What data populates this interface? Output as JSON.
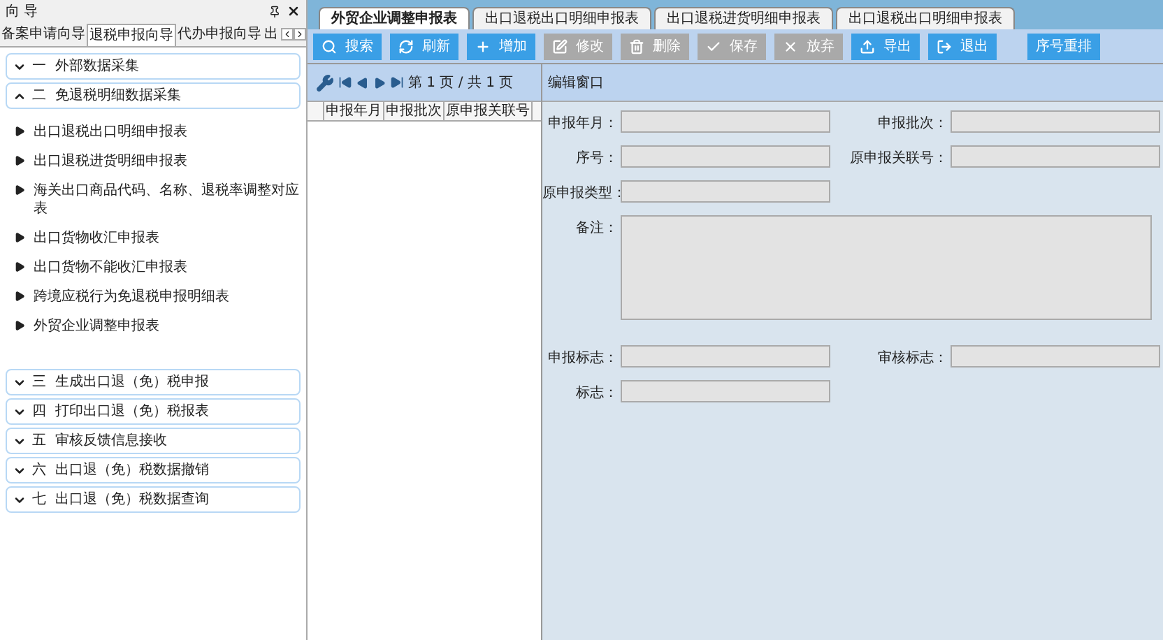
{
  "guide": {
    "title": "向 导",
    "tabs": [
      {
        "label": "备案申请向导",
        "selected": false
      },
      {
        "label": "退税申报向导",
        "selected": true
      },
      {
        "label": "代办申报向导",
        "selected": false
      },
      {
        "label": "出",
        "selected": false
      }
    ],
    "sections": [
      {
        "label": "一  外部数据采集",
        "expanded": false
      },
      {
        "label": "二  免退税明细数据采集",
        "expanded": true,
        "items": [
          "出口退税出口明细申报表",
          "出口退税进货明细申报表",
          "海关出口商品代码、名称、退税率调整对应表",
          "出口货物收汇申报表",
          "出口货物不能收汇申报表",
          "跨境应税行为免退税申报明细表",
          "外贸企业调整申报表"
        ]
      },
      {
        "label": "三  生成出口退（免）税申报",
        "expanded": false
      },
      {
        "label": "四  打印出口退（免）税报表",
        "expanded": false
      },
      {
        "label": "五  审核反馈信息接收",
        "expanded": false
      },
      {
        "label": "六  出口退（免）税数据撤销",
        "expanded": false
      },
      {
        "label": "七  出口退（免）税数据查询",
        "expanded": false
      }
    ]
  },
  "tabs": [
    {
      "label": "外贸企业调整申报表",
      "selected": true
    },
    {
      "label": "出口退税出口明细申报表",
      "selected": false
    },
    {
      "label": "出口退税进货明细申报表",
      "selected": false
    },
    {
      "label": "出口退税出口明细申报表",
      "selected": false
    }
  ],
  "toolbar": [
    {
      "label": "搜索",
      "kind": "search",
      "disabled": false
    },
    {
      "label": "刷新",
      "kind": "refresh",
      "disabled": false
    },
    {
      "label": "增加",
      "kind": "add",
      "disabled": false
    },
    {
      "label": "修改",
      "kind": "edit",
      "disabled": true
    },
    {
      "label": "删除",
      "kind": "delete",
      "disabled": true
    },
    {
      "label": "保存",
      "kind": "save",
      "disabled": true
    },
    {
      "label": "放弃",
      "kind": "cancel",
      "disabled": true
    },
    {
      "label": "导出",
      "kind": "export",
      "disabled": false
    },
    {
      "label": "退出",
      "kind": "exit",
      "disabled": false
    },
    {
      "label": "序号重排",
      "kind": "plain",
      "disabled": false
    }
  ],
  "pager": {
    "text": "第 1 页 / 共 1 页"
  },
  "table": {
    "columns": [
      "",
      "申报年月",
      "申报批次",
      "原申报关联号"
    ]
  },
  "form": {
    "title": "编辑窗口",
    "rows": [
      [
        {
          "label": "申报年月："
        },
        {
          "label": "申报批次："
        }
      ],
      [
        {
          "label": "序号："
        },
        {
          "label": "原申报关联号："
        }
      ],
      [
        {
          "label": "原申报类型："
        }
      ],
      [
        {
          "label": "备注：",
          "kind": "textarea"
        }
      ],
      [
        {
          "label": "申报标志："
        },
        {
          "label": "审核标志："
        }
      ],
      [
        {
          "label": "标志："
        }
      ]
    ]
  }
}
